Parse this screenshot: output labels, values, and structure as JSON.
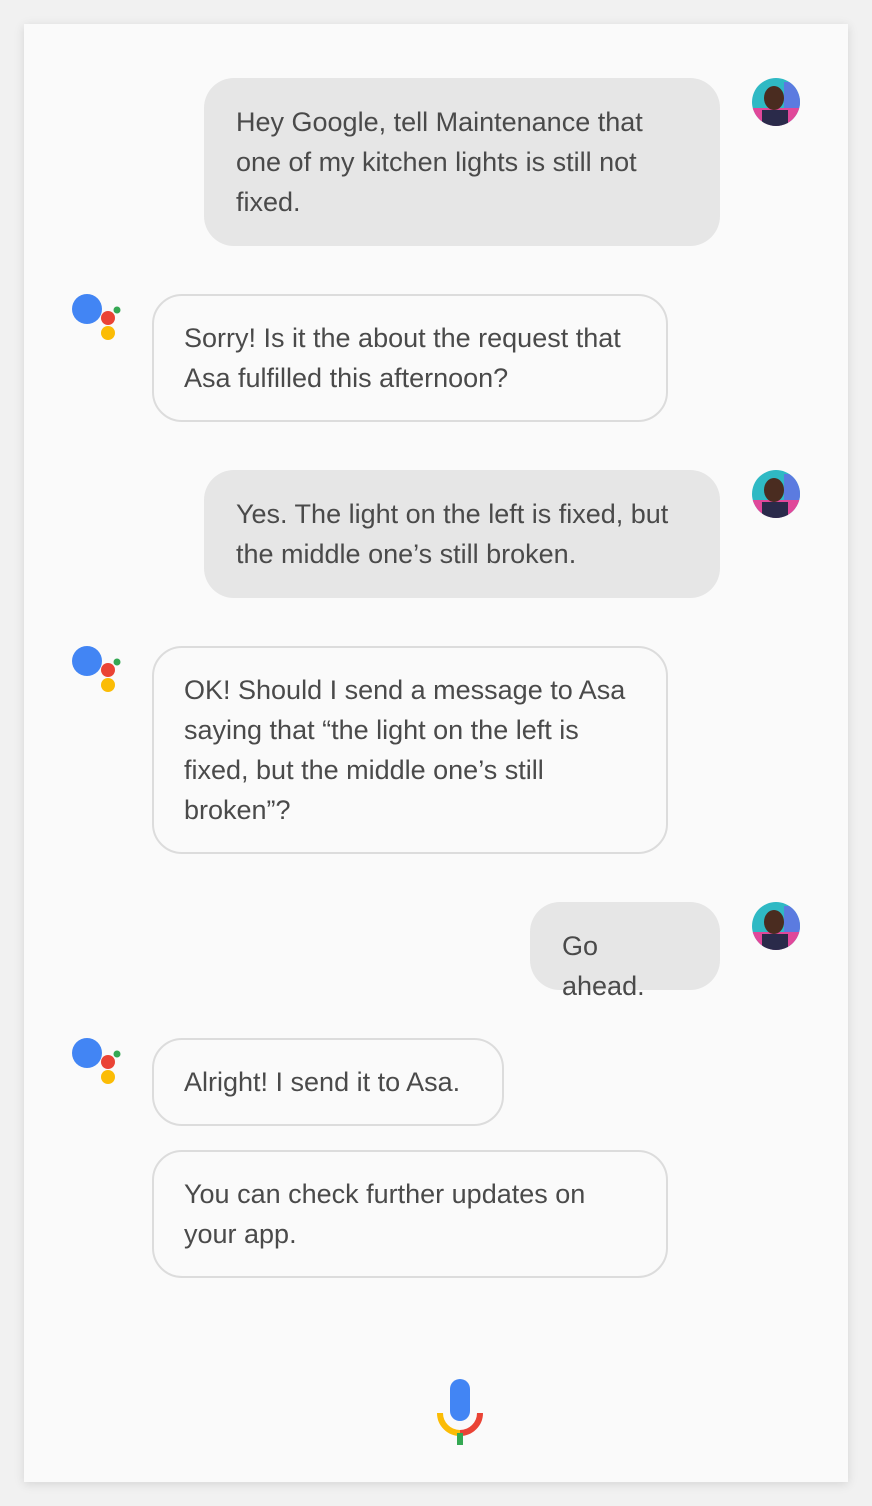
{
  "conversation": {
    "messages": [
      {
        "sender": "user",
        "text": "Hey Google, tell Maintenance that one of my kitchen lights is still not fixed."
      },
      {
        "sender": "assistant",
        "text": "Sorry! Is it the about the request that Asa fulfilled this afternoon?"
      },
      {
        "sender": "user",
        "text": "Yes. The light on the left is fixed, but the middle one’s still broken."
      },
      {
        "sender": "assistant",
        "text": "OK! Should I send a message to Asa saying that “the light on the left is fixed, but the middle one’s still broken”?"
      },
      {
        "sender": "user",
        "text": "Go ahead."
      },
      {
        "sender": "assistant",
        "text": "Alright! I send it to Asa."
      },
      {
        "sender": "assistant",
        "text": "You can check further updates on your app."
      }
    ]
  },
  "icons": {
    "assistant": "google-assistant-icon",
    "user": "user-avatar",
    "mic": "microphone-icon"
  },
  "colors": {
    "user_bubble": "#e6e6e6",
    "assistant_bubble_border": "#dcdcdc",
    "text": "#4a4a4a",
    "google_blue": "#4285f4",
    "google_red": "#ea4335",
    "google_yellow": "#fbbc05",
    "google_green": "#34a853"
  }
}
